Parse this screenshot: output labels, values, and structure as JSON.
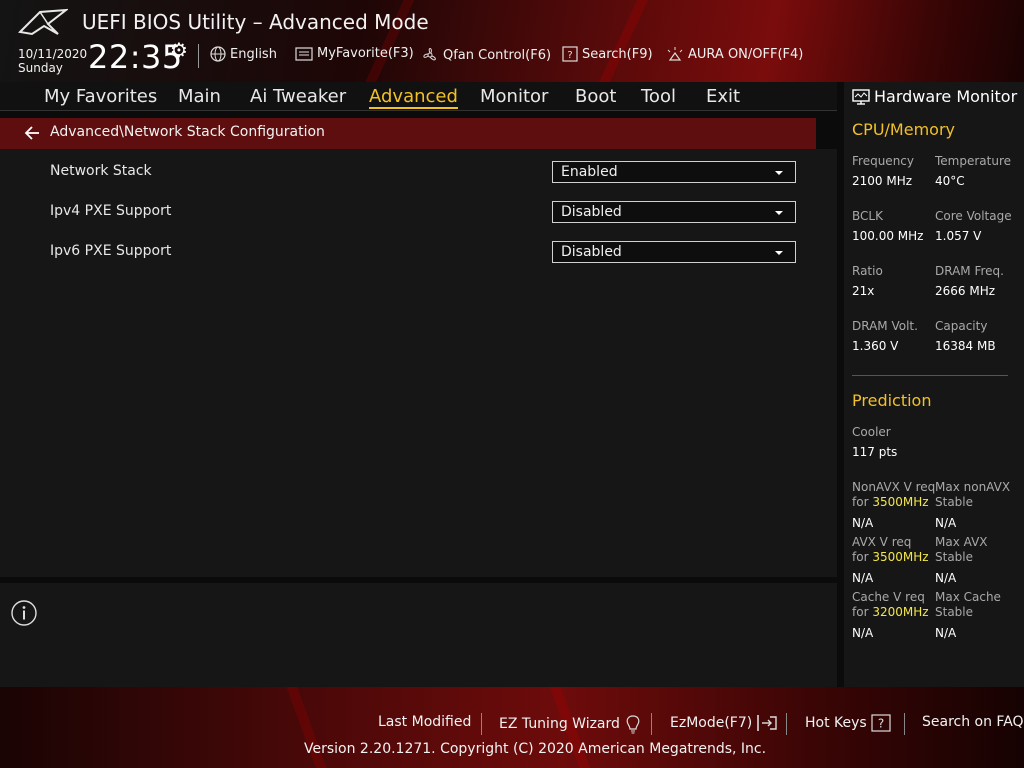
{
  "header": {
    "title": "UEFI BIOS Utility – Advanced Mode",
    "date": "10/11/2020",
    "day": "Sunday",
    "time": "22:35",
    "toolbar": {
      "language": "English",
      "myfavorite": "MyFavorite(F3)",
      "qfan": "Qfan Control(F6)",
      "search": "Search(F9)",
      "aura": "AURA ON/OFF(F4)"
    }
  },
  "menu": {
    "items": [
      "My Favorites",
      "Main",
      "Ai Tweaker",
      "Advanced",
      "Monitor",
      "Boot",
      "Tool",
      "Exit"
    ],
    "active": "Advanced"
  },
  "breadcrumb": "Advanced\\Network Stack Configuration",
  "settings": [
    {
      "label": "Network Stack",
      "value": "Enabled"
    },
    {
      "label": "Ipv4 PXE Support",
      "value": "Disabled"
    },
    {
      "label": "Ipv6 PXE Support",
      "value": "Disabled"
    }
  ],
  "hardware_monitor": {
    "title": "Hardware Monitor",
    "cpu_memory": {
      "heading": "CPU/Memory",
      "frequency": {
        "label": "Frequency",
        "value": "2100 MHz"
      },
      "temperature": {
        "label": "Temperature",
        "value": "40°C"
      },
      "bclk": {
        "label": "BCLK",
        "value": "100.00 MHz"
      },
      "core_voltage": {
        "label": "Core Voltage",
        "value": "1.057 V"
      },
      "ratio": {
        "label": "Ratio",
        "value": "21x"
      },
      "dram_freq": {
        "label": "DRAM Freq.",
        "value": "2666 MHz"
      },
      "dram_volt": {
        "label": "DRAM Volt.",
        "value": "1.360 V"
      },
      "capacity": {
        "label": "Capacity",
        "value": "16384 MB"
      }
    },
    "prediction": {
      "heading": "Prediction",
      "cooler": {
        "label": "Cooler",
        "value": "117 pts"
      },
      "nonavx_req": {
        "label1": "NonAVX V req",
        "label2": "for",
        "freq": "3500MHz",
        "value": "N/A"
      },
      "max_nonavx": {
        "label1": "Max nonAVX",
        "label2": "Stable",
        "value": "N/A"
      },
      "avx_req": {
        "label1": "AVX V req",
        "label2": "for",
        "freq": "3500MHz",
        "value": "N/A"
      },
      "max_avx": {
        "label1": "Max AVX",
        "label2": "Stable",
        "value": "N/A"
      },
      "cache_req": {
        "label1": "Cache V req",
        "label2": "for",
        "freq": "3200MHz",
        "value": "N/A"
      },
      "max_cache": {
        "label1": "Max Cache",
        "label2": "Stable",
        "value": "N/A"
      }
    }
  },
  "footer": {
    "last_modified": "Last Modified",
    "ez_tuning": "EZ Tuning Wizard",
    "ezmode": "EzMode(F7)",
    "hot_keys": "Hot Keys",
    "hot_keys_glyph": "?",
    "search_faq": "Search on FAQ",
    "copyright": "Version 2.20.1271. Copyright (C) 2020 American Megatrends, Inc."
  },
  "colors": {
    "accent": "#f2c029",
    "highlight": "#f2e64a",
    "breadcrumb_bg": "#5e0e0e",
    "panel_bg": "#161616"
  }
}
